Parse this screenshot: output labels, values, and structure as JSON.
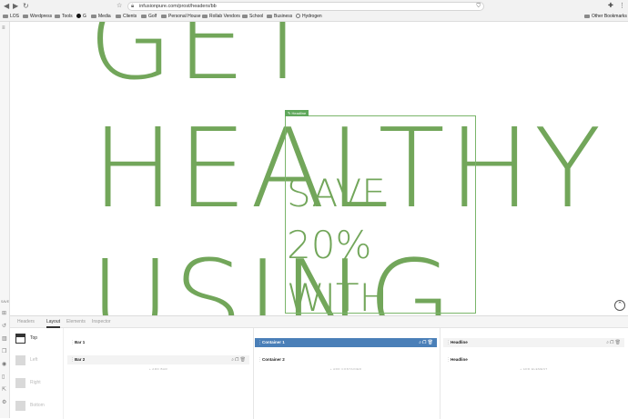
{
  "browser": {
    "url": "infusionpure.com/prost/headers/bb",
    "bookmarks": [
      "LOS",
      "Wordpress",
      "Tools",
      "G",
      "Media",
      "Clients",
      "Golf",
      "Personal House",
      "Rollab Vendors",
      "School",
      "Business",
      "Hydrogen"
    ],
    "other_bookmarks": "Other Bookmarks"
  },
  "rail": {
    "label": "SAVE"
  },
  "hero": {
    "line1": "GET",
    "line2": "HEALTHY",
    "line3": "USING",
    "tag": "✎ Headline",
    "sub1": "SAVE",
    "sub2": "20%",
    "sub3": "WITH"
  },
  "panel": {
    "tabs": [
      "Headers",
      "Layout",
      "Elements",
      "Inspector"
    ],
    "side": [
      "Top",
      "Left",
      "Right",
      "Bottom"
    ],
    "col1": {
      "rows": [
        "Bar 1",
        "Bar 2"
      ],
      "add": "+ ADD BAR"
    },
    "col2": {
      "rows": [
        "Container 1",
        "Container 2"
      ],
      "add": "+ ADD CONTAINER"
    },
    "col3": {
      "rows": [
        "Headline",
        "Headline"
      ],
      "add": "+ ADD ELEMENT"
    }
  },
  "colors": {
    "brand_green": "#72a65a",
    "selection_blue": "#4a7fb8"
  }
}
